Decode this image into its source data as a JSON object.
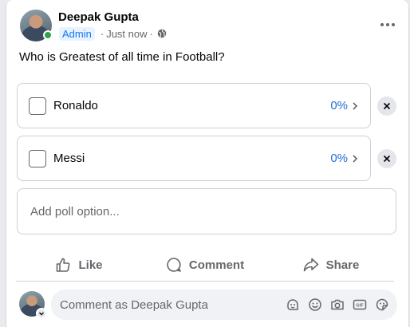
{
  "post": {
    "author": "Deepak Gupta",
    "badge": "Admin",
    "time": "Just now",
    "separator": "·",
    "more_icon": "more-horizontal-icon",
    "question": "Who is Greatest of all time in Football?"
  },
  "poll": {
    "options": [
      {
        "label": "Ronaldo",
        "percent": "0%"
      },
      {
        "label": "Messi",
        "percent": "0%"
      }
    ],
    "add_placeholder": "Add poll option..."
  },
  "actions": {
    "like": "Like",
    "comment": "Comment",
    "share": "Share"
  },
  "comment": {
    "placeholder": "Comment as Deepak Gupta"
  },
  "colors": {
    "accent": "#1877f2",
    "percent": "#216fdb",
    "online": "#31a24c",
    "muted": "#65676b"
  }
}
